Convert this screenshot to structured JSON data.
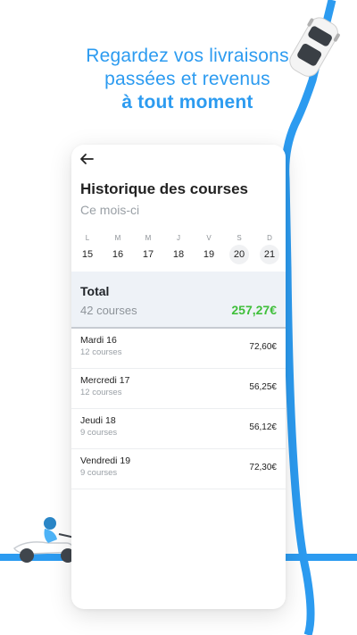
{
  "headline": {
    "line1": "Regardez vos livraisons",
    "line2": "passées et revenus",
    "line3": "à tout moment"
  },
  "card": {
    "title": "Historique des courses",
    "subtitle": "Ce mois-ci",
    "week": [
      {
        "letter": "L",
        "num": "15"
      },
      {
        "letter": "M",
        "num": "16"
      },
      {
        "letter": "M",
        "num": "17"
      },
      {
        "letter": "J",
        "num": "18"
      },
      {
        "letter": "V",
        "num": "19"
      },
      {
        "letter": "S",
        "num": "20"
      },
      {
        "letter": "D",
        "num": "21"
      }
    ],
    "total": {
      "label": "Total",
      "count": "42 courses",
      "amount": "257,27€"
    },
    "rows": [
      {
        "day": "Mardi 16",
        "count": "12 courses",
        "amount": "72,60€"
      },
      {
        "day": "Mercredi 17",
        "count": "12 courses",
        "amount": "56,25€"
      },
      {
        "day": "Jeudi 18",
        "count": "9 courses",
        "amount": "56,12€"
      },
      {
        "day": "Vendredi 19",
        "count": "9 courses",
        "amount": "72,30€"
      }
    ]
  },
  "colors": {
    "accent_blue": "#2c9bf0",
    "positive_green": "#3fbf3a"
  },
  "icons": {
    "back": "arrow-left-icon",
    "car": "car-icon",
    "scooter": "delivery-scooter-icon"
  }
}
